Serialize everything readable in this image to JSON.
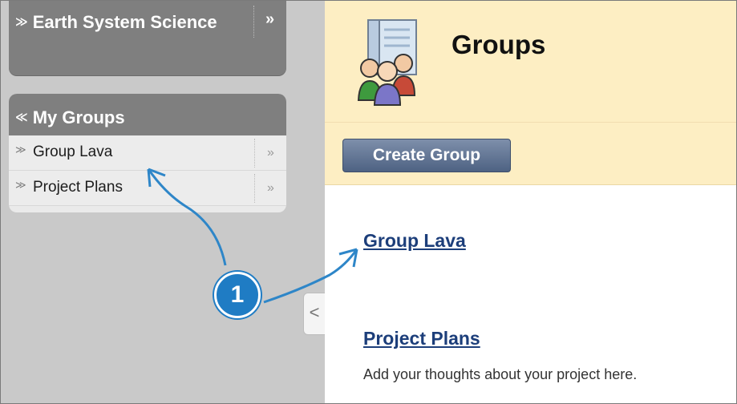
{
  "sidebar": {
    "course": {
      "title": "Earth System Science",
      "go_glyph": "»",
      "toggle_glyph": "≫"
    },
    "my_groups": {
      "title": "My Groups",
      "toggle_glyph": "≪",
      "items": [
        {
          "label": "Group Lava",
          "toggle_glyph": "≫",
          "go_glyph": "»"
        },
        {
          "label": "Project Plans",
          "toggle_glyph": "≫",
          "go_glyph": "»"
        }
      ]
    },
    "collapse_glyph": "<"
  },
  "main": {
    "title": "Groups",
    "create_button": "Create Group",
    "groups": [
      {
        "name": "Group Lava",
        "description": ""
      },
      {
        "name": "Project Plans",
        "description": "Add your thoughts about your project here."
      }
    ]
  },
  "callout": {
    "number": "1",
    "color": "#1f7cc4"
  },
  "icons": {
    "header": "groups-icon",
    "course_toggle": "chevron-down-icon",
    "collapse": "chevron-left-icon"
  },
  "colors": {
    "header_bg": "#fdeec3",
    "sidebar_bg": "#c9c9c9",
    "menu_header_bg": "#7f7f7f",
    "button_bg": "#5a6e8d",
    "link": "#1c3e7a",
    "callout": "#1f7cc4"
  }
}
